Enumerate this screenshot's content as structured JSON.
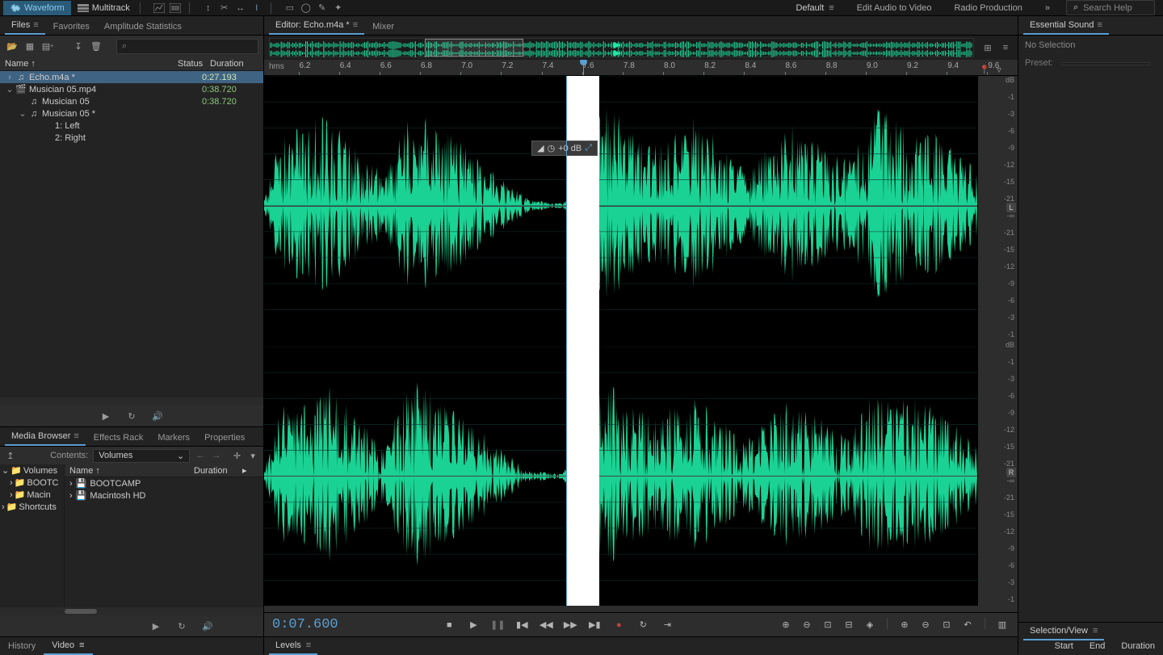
{
  "topbar": {
    "mode_waveform": "Waveform",
    "mode_multitrack": "Multitrack",
    "ws_default": "Default",
    "ws_edit_av": "Edit Audio to Video",
    "ws_radio": "Radio Production",
    "search_placeholder": "Search Help"
  },
  "files": {
    "tab_files": "Files",
    "tab_fav": "Favorites",
    "tab_amp": "Amplitude Statistics",
    "col_name": "Name",
    "col_status": "Status",
    "col_dur": "Duration",
    "items": [
      {
        "name": "Echo.m4a *",
        "dur": "0:27.193",
        "sel": true,
        "indent": 0,
        "chev": "›",
        "ico": "audio"
      },
      {
        "name": "Musician 05.mp4",
        "dur": "0:38.720",
        "indent": 0,
        "chev": "⌄",
        "ico": "video"
      },
      {
        "name": "Musician 05",
        "dur": "0:38.720",
        "indent": 1,
        "ico": "audio"
      },
      {
        "name": "Musician 05 *",
        "dur": "",
        "indent": 1,
        "chev": "⌄",
        "ico": "audio"
      },
      {
        "name": "1: Left",
        "dur": "",
        "indent": 2
      },
      {
        "name": "2: Right",
        "dur": "",
        "indent": 2
      }
    ]
  },
  "media": {
    "tab_mb": "Media Browser",
    "tab_fx": "Effects Rack",
    "tab_mark": "Markers",
    "tab_prop": "Properties",
    "contents_lbl": "Contents:",
    "contents_val": "Volumes",
    "col_name": "Name",
    "col_dur": "Duration",
    "tree": [
      {
        "name": "Volumes",
        "chev": "⌄",
        "indent": 0
      },
      {
        "name": "BOOTC",
        "chev": "›",
        "indent": 1
      },
      {
        "name": "Macin",
        "chev": "›",
        "indent": 1
      },
      {
        "name": "Shortcuts",
        "chev": "›",
        "indent": 0
      }
    ],
    "list": [
      {
        "name": "BOOTCAMP",
        "chev": "›"
      },
      {
        "name": "Macintosh HD",
        "chev": "›"
      }
    ]
  },
  "bottom_left": {
    "tab_history": "History",
    "tab_video": "Video"
  },
  "editor": {
    "tab_editor": "Editor: Echo.m4a *",
    "tab_mixer": "Mixer",
    "hms": "hms",
    "ruler_ticks": [
      "6.2",
      "6.4",
      "6.6",
      "6.8",
      "7.0",
      "7.2",
      "7.4",
      "7.6",
      "7.8",
      "8.0",
      "8.2",
      "8.4",
      "8.6",
      "8.8",
      "9.0",
      "9.2",
      "9.4",
      "9.6"
    ],
    "hud_db": "+0 dB",
    "time": "0:07.600",
    "db_labels": [
      "dB",
      "-1",
      "-3",
      "-6",
      "-9",
      "-12",
      "-15",
      "-21",
      "-∞",
      "-21",
      "-15",
      "-12",
      "-9",
      "-6",
      "-3",
      "-1"
    ],
    "ch_left": "L",
    "ch_right": "R"
  },
  "levels": {
    "tab": "Levels"
  },
  "es": {
    "tab": "Essential Sound",
    "no_sel": "No Selection",
    "preset_lbl": "Preset:",
    "preset_val": ""
  },
  "selview": {
    "tab": "Selection/View",
    "cols": [
      "Start",
      "End",
      "Duration"
    ]
  }
}
